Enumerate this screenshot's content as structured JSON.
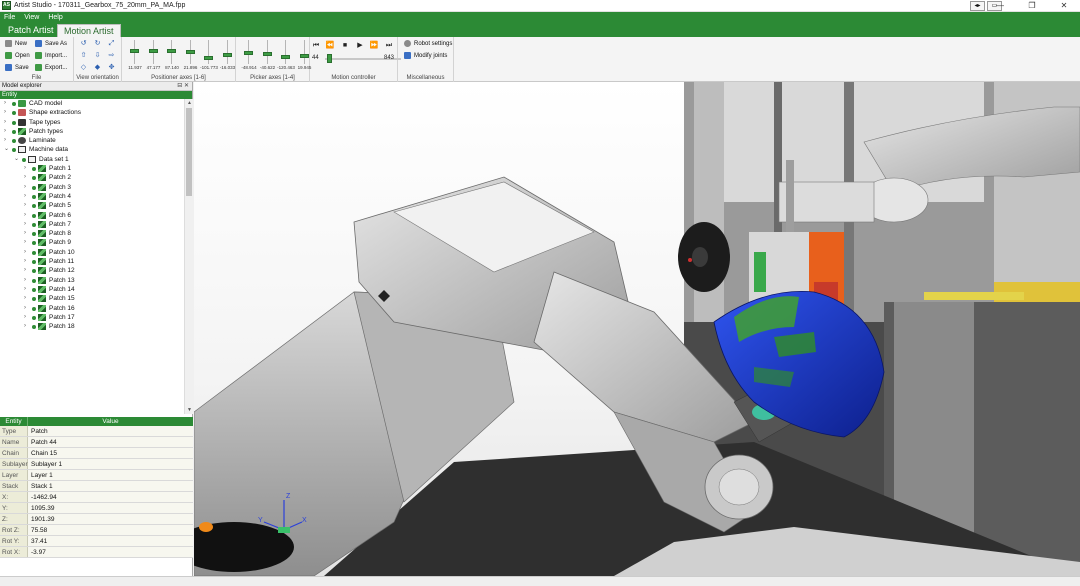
{
  "window": {
    "title": "Artist Studio - 170311_Gearbox_75_20mm_PA_MA.fpp",
    "app_icon": "AS"
  },
  "menu": [
    "File",
    "View",
    "Help"
  ],
  "tabs": [
    {
      "label": "Patch Artist",
      "active": false
    },
    {
      "label": "Motion Artist",
      "active": true
    }
  ],
  "ribbon": {
    "file": {
      "label": "File",
      "buttons": {
        "new": "New",
        "save_as": "Save As",
        "open": "Open",
        "import": "Import...",
        "save": "Save",
        "export": "Export..."
      }
    },
    "view_orientation": {
      "label": "View orientation"
    },
    "positioner_axes": {
      "label": "Positioner axes [1-6]",
      "values": [
        "11.937",
        "47.177",
        "87.140",
        "21.896",
        "-101.773",
        "-16.033"
      ],
      "levels": [
        0.55,
        0.55,
        0.55,
        0.5,
        0.2,
        0.35
      ]
    },
    "picker_axes": {
      "label": "Picker axes [1-4]",
      "values": [
        "-48.914",
        "-40.622",
        "-120.463",
        "19.945"
      ],
      "levels": [
        0.45,
        0.4,
        0.25,
        0.3
      ]
    },
    "motion_controller": {
      "label": "Motion controller",
      "current": "44",
      "max": "843",
      "progress": 0.05
    },
    "misc": {
      "label": "Miscellaneous",
      "robot_settings": "Robot settings",
      "modify_joints": "Modify joints"
    }
  },
  "model_explorer": {
    "title": "Model explorer",
    "column": "Entity",
    "items": [
      {
        "label": "CAD model",
        "icon": "cad",
        "level": 0
      },
      {
        "label": "Shape extractions",
        "icon": "shape",
        "level": 0
      },
      {
        "label": "Tape types",
        "icon": "tape",
        "level": 0
      },
      {
        "label": "Patch types",
        "icon": "patch",
        "level": 0
      },
      {
        "label": "Laminate",
        "icon": "lam",
        "level": 0
      },
      {
        "label": "Machine data",
        "icon": "folder",
        "level": 0,
        "expanded": true
      },
      {
        "label": "Data set 1",
        "icon": "folder",
        "level": 1,
        "expanded": true
      },
      {
        "label": "Patch 1",
        "icon": "patch",
        "level": 2
      },
      {
        "label": "Patch 2",
        "icon": "patch",
        "level": 2
      },
      {
        "label": "Patch 3",
        "icon": "patch",
        "level": 2
      },
      {
        "label": "Patch 4",
        "icon": "patch",
        "level": 2
      },
      {
        "label": "Patch 5",
        "icon": "patch",
        "level": 2
      },
      {
        "label": "Patch 6",
        "icon": "patch",
        "level": 2
      },
      {
        "label": "Patch 7",
        "icon": "patch",
        "level": 2
      },
      {
        "label": "Patch 8",
        "icon": "patch",
        "level": 2
      },
      {
        "label": "Patch 9",
        "icon": "patch",
        "level": 2
      },
      {
        "label": "Patch 10",
        "icon": "patch",
        "level": 2
      },
      {
        "label": "Patch 11",
        "icon": "patch",
        "level": 2
      },
      {
        "label": "Patch 12",
        "icon": "patch",
        "level": 2
      },
      {
        "label": "Patch 13",
        "icon": "patch",
        "level": 2
      },
      {
        "label": "Patch 14",
        "icon": "patch",
        "level": 2
      },
      {
        "label": "Patch 15",
        "icon": "patch",
        "level": 2
      },
      {
        "label": "Patch 16",
        "icon": "patch",
        "level": 2
      },
      {
        "label": "Patch 17",
        "icon": "patch",
        "level": 2
      },
      {
        "label": "Patch 18",
        "icon": "patch",
        "level": 2
      }
    ]
  },
  "properties": {
    "headers": [
      "Entity",
      "Value"
    ],
    "rows": [
      {
        "key": "Type",
        "value": "Patch"
      },
      {
        "key": "Name",
        "value": "Patch 44"
      },
      {
        "key": "Chain",
        "value": "Chain 15"
      },
      {
        "key": "Sublayer",
        "value": "Sublayer 1"
      },
      {
        "key": "Layer",
        "value": "Layer 1"
      },
      {
        "key": "Stack",
        "value": "Stack 1"
      },
      {
        "key": "X:",
        "value": "-1462.94"
      },
      {
        "key": "Y:",
        "value": "1095.39"
      },
      {
        "key": "Z:",
        "value": "1901.39"
      },
      {
        "key": "Rot Z:",
        "value": "75.58"
      },
      {
        "key": "Rot Y:",
        "value": "37.41"
      },
      {
        "key": "Rot X:",
        "value": "-3.97"
      }
    ]
  },
  "viewport": {
    "axes": {
      "x": "X",
      "y": "Y",
      "z": "Z"
    }
  },
  "colors": {
    "accent": "#2c8a35",
    "part": "#1a3fd1",
    "patch": "#3f9b3a"
  }
}
